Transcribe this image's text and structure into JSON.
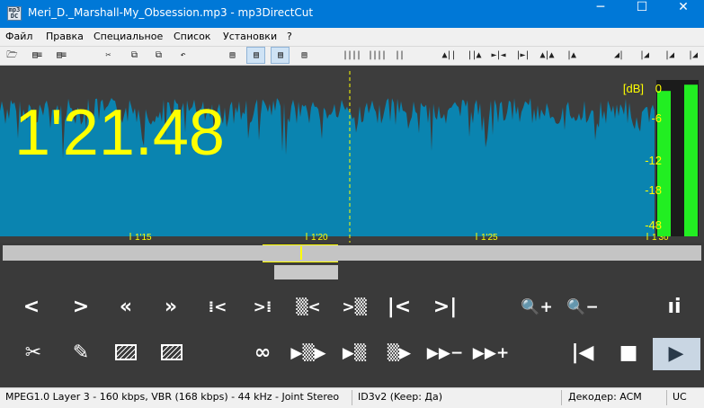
{
  "window": {
    "title": "Meri_D._Marshall-My_Obsession.mp3 - mp3DirectCut",
    "icon_text": "mp3 DC",
    "minimize": "─",
    "maximize": "☐",
    "close": "✕"
  },
  "menu": [
    "Файл",
    "Правка",
    "Специальное",
    "Список",
    "Установки",
    "?"
  ],
  "toolbar": {
    "file": [
      "open-icon",
      "save-icon",
      "save-list-icon"
    ],
    "edit": [
      "cut-icon",
      "copy-icon",
      "paste-icon",
      "undo-icon"
    ],
    "doc": [
      "info-icon",
      "cue-icon",
      "split-icon",
      "list-icon"
    ],
    "view": [
      "zoom-icon",
      "zoom-icon",
      "pause-icon"
    ],
    "nav": [
      "go-start-icon",
      "go-end-icon",
      "go-prev-icon",
      "go-next-icon",
      "go-mark-icon",
      "level-icon",
      "level-icon",
      "marker-icon"
    ]
  },
  "display": {
    "time": "1'21.48",
    "db_label": "[dB]",
    "db_scale": [
      "0",
      "-6",
      "-12",
      "-18",
      "-48"
    ],
    "time_ticks": [
      "1'15",
      "1'20",
      "1'25",
      "1'30"
    ],
    "level_left": 0.93,
    "level_right": 0.97,
    "wave_color": "#0a84b0",
    "accent": "#ffff00",
    "meter_color": "#22ee22"
  },
  "controls": {
    "row1": {
      "prev": "<",
      "next": ">",
      "rewind": "«",
      "forward": "»",
      "sel_start": "⁞<",
      "sel_end": ">⁞",
      "cue_start": "▒<",
      "cue_end": ">▒",
      "to_start": "|<",
      "to_end": ">|",
      "zoom_in": "🔍+",
      "zoom_out": "🔍−",
      "mode": "ıi"
    },
    "row2": {
      "cut": "✂",
      "edit": "✎",
      "loop": "∞",
      "play_sel": "▶▒▶",
      "play_cut": "▶▒",
      "play_end": "▒▶",
      "play_next": "▶▶−",
      "play_more": "▶▶+",
      "home": "|◀",
      "stop": "■",
      "play": "▶"
    }
  },
  "status": {
    "format": "MPEG1.0 Layer 3 - 160 kbps, VBR (168 kbps) - 44 kHz - Joint Stereo",
    "tag": "ID3v2 (Keep: Да)",
    "decoder": "Декодер: ACM",
    "mode": "UC"
  }
}
